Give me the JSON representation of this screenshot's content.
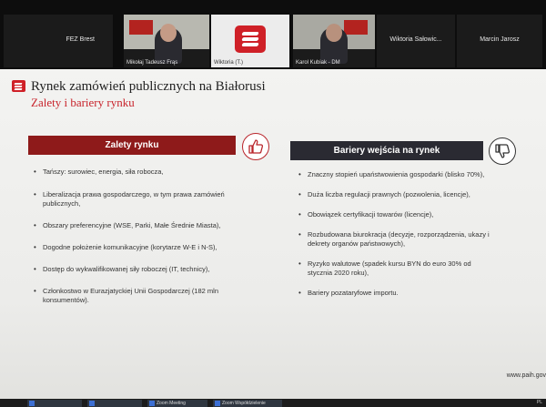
{
  "participants": [
    {
      "name": "FEZ Brest",
      "view": "name-only"
    },
    {
      "name": "Mikołaj Tadeusz Frąs",
      "view": "camera"
    },
    {
      "name": "Wiktoria (T.)",
      "view": "logo"
    },
    {
      "name": "Karol Kubiak - DM",
      "view": "camera"
    },
    {
      "name": "Wiktoria Sałowic...",
      "view": "name-only"
    },
    {
      "name": "Marcin Jarosz",
      "view": "name-only"
    }
  ],
  "slide": {
    "title": "Rynek zamówień publicznych na Białorusi",
    "subtitle": "Zalety i bariery rynku",
    "advantages": {
      "header": "Zalety rynku",
      "icon": "thumbs-up-icon",
      "items": [
        "Tańszy: surowiec, energia, siła robocza,",
        "Liberalizacja prawa gospodarczego, w tym prawa zamówień publicznych,",
        "Obszary preferencyjne (WSE, Parki, Małe Średnie Miasta),",
        "Dogodne położenie komunikacyjne (korytarze W-E i N-S),",
        "Dostęp do wykwalifikowanej siły roboczej (IT, technicy),",
        "Członkostwo w Eurazjatyckiej Unii Gospodarczej (182 mln konsumentów)."
      ]
    },
    "barriers": {
      "header": "Bariery wejścia na rynek",
      "icon": "thumbs-down-icon",
      "items": [
        "Znaczny stopień upaństwowienia gospodarki (blisko 70%),",
        "Duża liczba regulacji prawnych (pozwolenia, licencje),",
        "Obowiązek certyfikacji towarów (licencje),",
        "Rozbudowana biurokracja (decyzje, rozporządzenia, ukazy i dekrety organów państwowych),",
        "Ryzyko walutowe (spadek kursu BYN do euro 30% od stycznia 2020 roku),",
        "Bariery pozataryfowe importu."
      ]
    },
    "footer_url": "www.paih.gov"
  },
  "taskbar": {
    "items": [
      "",
      "",
      "Zoom Meeting",
      "Zoom Współdzielenie"
    ],
    "tray_text": "PL"
  },
  "colors": {
    "accent_red": "#cf2027",
    "advantages_header": "#8e1a1a",
    "barriers_header": "#2a2a32"
  }
}
